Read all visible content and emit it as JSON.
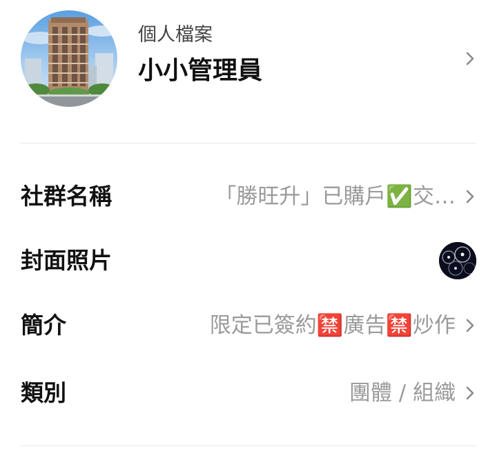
{
  "profile": {
    "caption": "個人檔案",
    "name": "小小管理員"
  },
  "settings": {
    "name": {
      "label": "社群名稱",
      "value": "「勝旺升」已購戶✅交…"
    },
    "cover": {
      "label": "封面照片"
    },
    "intro": {
      "label": "簡介",
      "value": "限定已簽約🈲廣告🈲炒作"
    },
    "category": {
      "label": "類別",
      "value": "團體 / 組織"
    }
  },
  "icons": {
    "chevron": "chevron-right-icon"
  },
  "colors": {
    "label": "#111111",
    "value": "#9a9a9a",
    "chevron": "#8a8a8a",
    "divider": "#e6e6e6"
  }
}
